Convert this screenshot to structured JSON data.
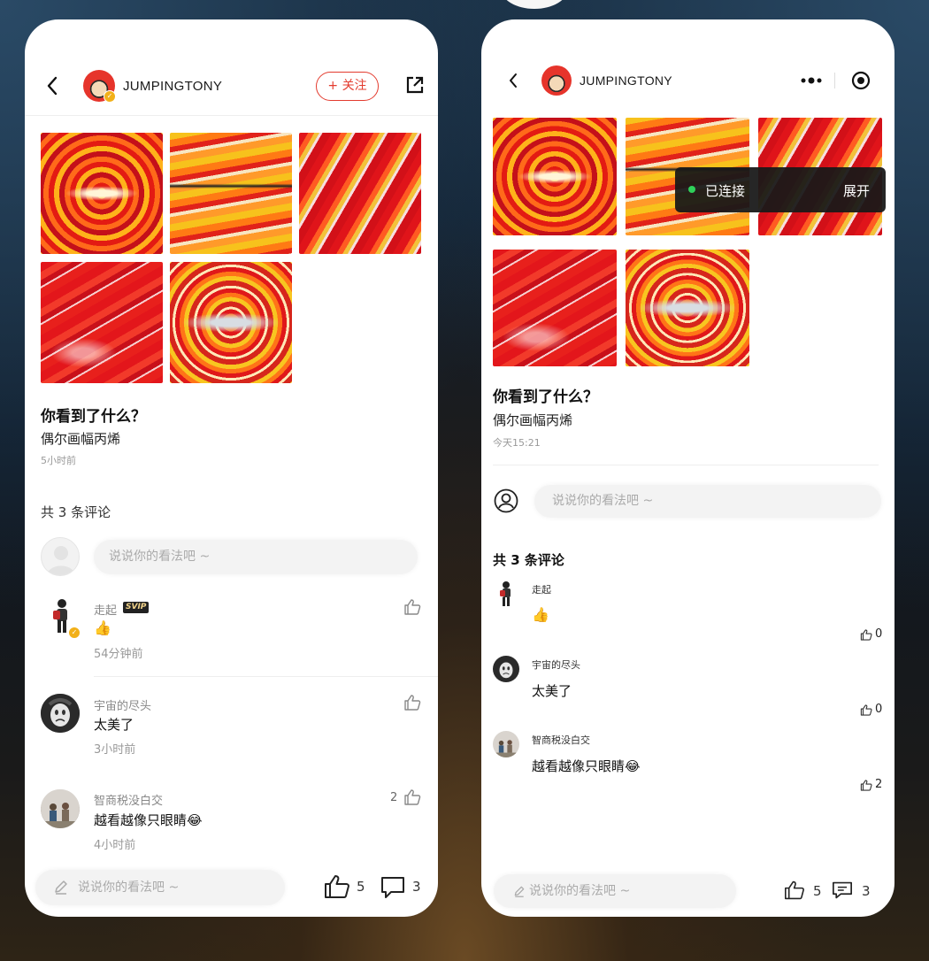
{
  "left": {
    "username": "JUMPINGTONY",
    "follow_label": "+ 关注",
    "post": {
      "title": "你看到了什么？",
      "body": "偶尔画幅丙烯",
      "time": "5小时前"
    },
    "comments_header": "共 3 条评论",
    "comment_placeholder": "说说你的看法吧 ~",
    "comments": [
      {
        "name": "走起",
        "badge": "SVIP",
        "text": "👍",
        "time": "54分钟前",
        "likes": ""
      },
      {
        "name": "宇宙的尽头",
        "text": "太美了",
        "time": "3小时前",
        "likes": ""
      },
      {
        "name": "智商税没白交",
        "text": "越看越像只眼睛😂",
        "time": "4小时前",
        "likes": "2"
      }
    ],
    "footer": {
      "placeholder": "说说你的看法吧 ~",
      "like_count": "5",
      "comment_count": "3"
    }
  },
  "right": {
    "username": "JUMPINGTONY",
    "toast": {
      "status": "已连接",
      "action": "展开"
    },
    "post": {
      "title": "你看到了什么？",
      "body": "偶尔画幅丙烯",
      "time": "今天15:21"
    },
    "comment_placeholder": "说说你的看法吧 ~",
    "comments_header": "共 3 条评论",
    "comments": [
      {
        "name": "走起",
        "text": "👍",
        "likes": "0"
      },
      {
        "name": "宇宙的尽头",
        "text": "太美了",
        "likes": "0"
      },
      {
        "name": "智商税没白交",
        "text": "越看越像只眼睛😂",
        "likes": "2"
      }
    ],
    "footer": {
      "placeholder": "说说你的看法吧 ~",
      "like_count": "5",
      "comment_count": "3"
    }
  },
  "icons": {
    "back": "chevron-left-icon",
    "share": "share-external-icon",
    "more": "more-dots-icon",
    "close": "mini-program-close-icon",
    "like": "thumb-up-icon",
    "comment": "comment-bubble-icon",
    "pen": "pen-icon",
    "user": "user-outline-icon"
  },
  "colors": {
    "accent": "#e33b2e",
    "connected": "#2fd05a"
  }
}
